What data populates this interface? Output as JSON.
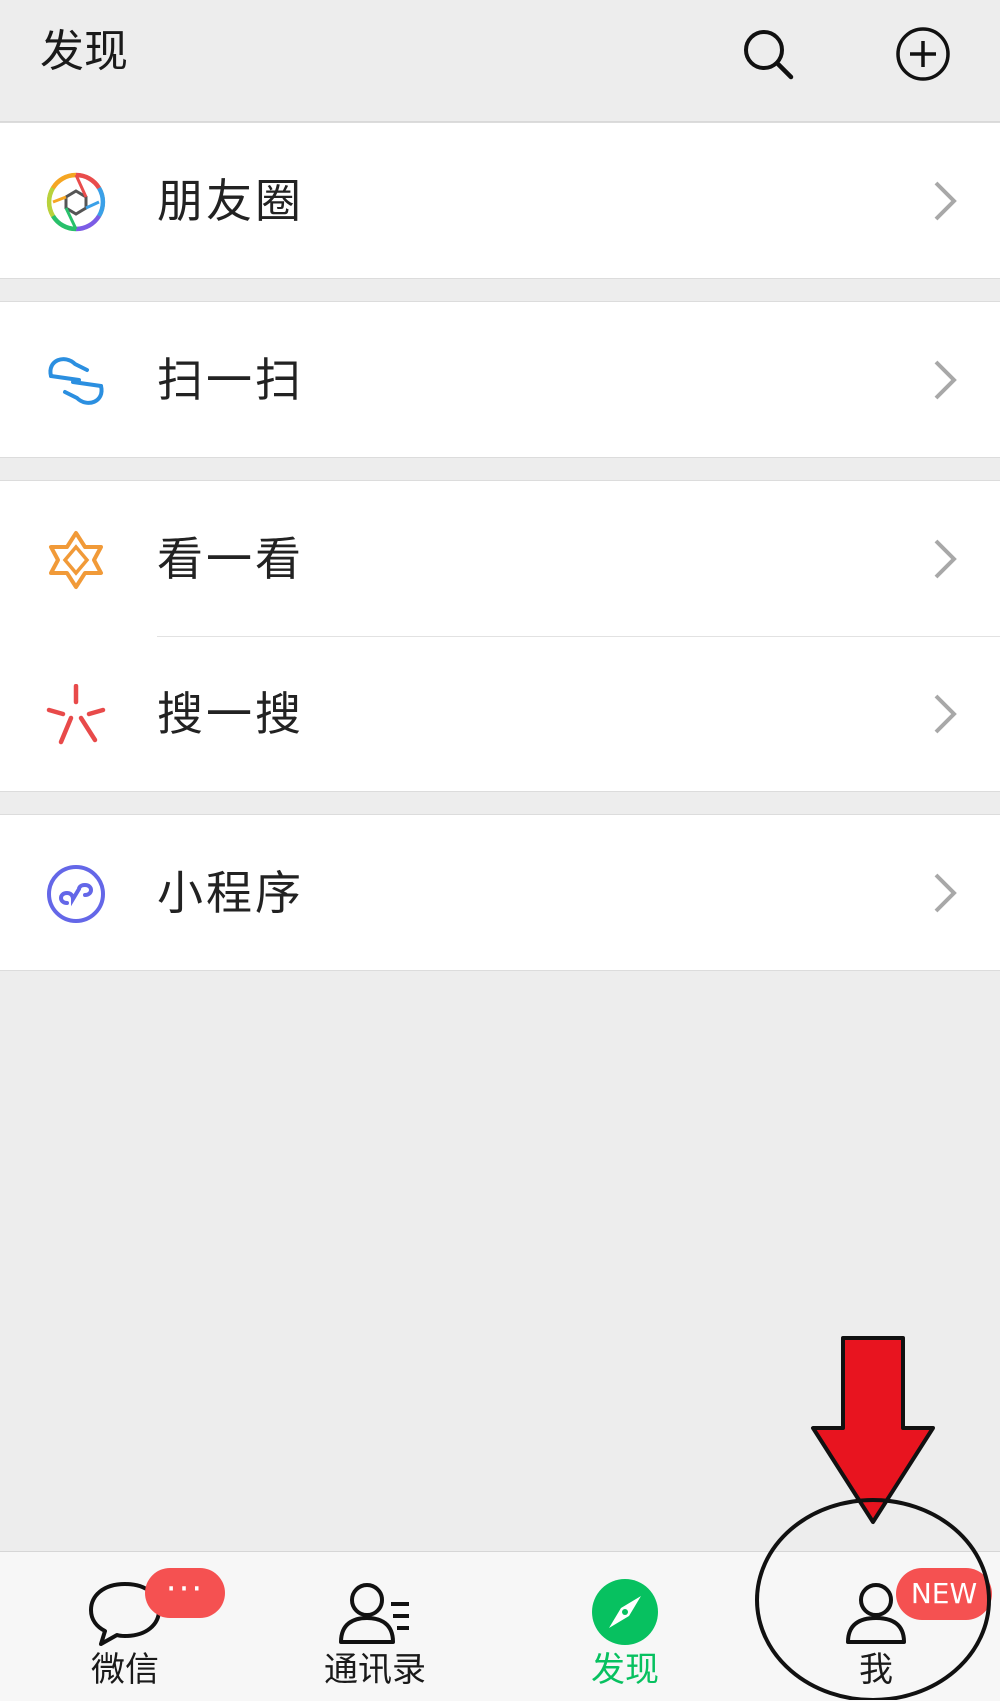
{
  "header": {
    "title": "发现",
    "search_icon": "search-icon",
    "add_icon": "plus-circle-icon"
  },
  "menu": {
    "moments": {
      "label": "朋友圈",
      "icon": "moments-aperture-icon"
    },
    "scan": {
      "label": "扫一扫",
      "icon": "scan-icon"
    },
    "top_stories": {
      "label": "看一看",
      "icon": "top-stories-icon"
    },
    "search": {
      "label": "搜一搜",
      "icon": "search-sparkle-icon"
    },
    "mini_programs": {
      "label": "小程序",
      "icon": "mini-program-icon"
    }
  },
  "tabbar": {
    "chats": {
      "label": "微信",
      "badge": "···"
    },
    "contacts": {
      "label": "通讯录"
    },
    "discover": {
      "label": "发现",
      "active": true
    },
    "me": {
      "label": "我",
      "badge": "NEW"
    }
  },
  "colors": {
    "accent_green": "#07c160",
    "badge_red": "#f55151",
    "annotation_arrow_red": "#e8141f",
    "background": "#ededed"
  }
}
